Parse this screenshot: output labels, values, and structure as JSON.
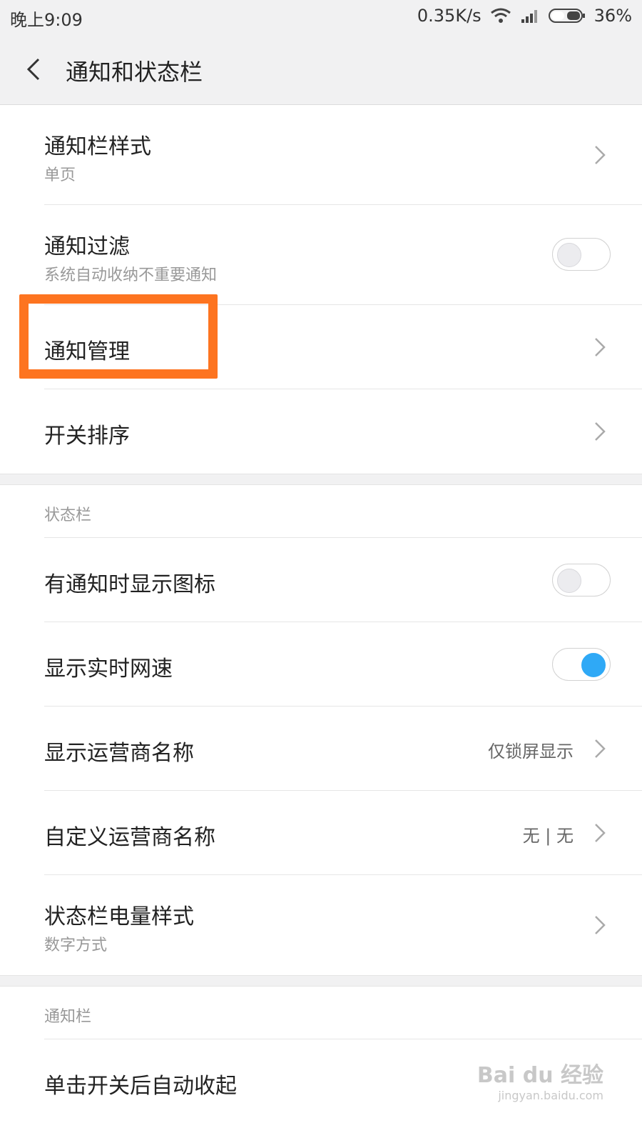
{
  "status_bar": {
    "time": "晚上9:09",
    "net_speed": "0.35K/s",
    "battery": "36%",
    "icons": [
      "wifi-icon",
      "signal-icon",
      "battery-icon"
    ]
  },
  "header": {
    "title": "通知和状态栏",
    "back_icon": "back-icon"
  },
  "rows": {
    "notif_style": {
      "label": "通知栏样式",
      "sub": "单页"
    },
    "notif_filter": {
      "label": "通知过滤",
      "sub": "系统自动收纳不重要通知",
      "toggle": "off"
    },
    "notif_manage": {
      "label": "通知管理"
    },
    "switch_order": {
      "label": "开关排序"
    },
    "show_icons": {
      "label": "有通知时显示图标",
      "toggle": "off"
    },
    "show_speed": {
      "label": "显示实时网速",
      "toggle": "on"
    },
    "carrier_name": {
      "label": "显示运营商名称",
      "value": "仅锁屏显示"
    },
    "custom_carrier": {
      "label": "自定义运营商名称",
      "value": "无 | 无"
    },
    "battery_style": {
      "label": "状态栏电量样式",
      "sub": "数字方式"
    },
    "auto_collapse": {
      "label": "单击开关后自动收起"
    }
  },
  "sections": {
    "status_bar": "状态栏",
    "notif_bar": "通知栏"
  },
  "watermark": {
    "text": "Bai du 经验",
    "sub": "jingyan.baidu.com"
  },
  "colors": {
    "accent": "#2fa9f6",
    "highlight": "#fd7420"
  }
}
